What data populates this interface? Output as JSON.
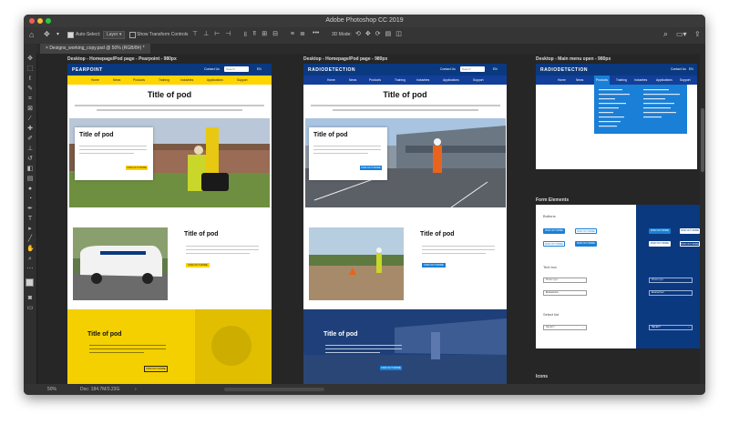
{
  "window": {
    "title": "Adobe Photoshop CC 2019",
    "traffic_colors": [
      "#ee5f57",
      "#f5bf2f",
      "#2bc840"
    ]
  },
  "options_bar": {
    "home_icon": "home-icon",
    "move_icon": "move-tool-icon",
    "auto_select_label": "Auto-Select:",
    "auto_select_value": "Layer",
    "transform_label": "Show Transform Controls",
    "more_label": "•••",
    "mode_3d_label": "3D Mode:",
    "right_icons": [
      "search-icon",
      "workspace-icon",
      "share-icon"
    ]
  },
  "document_tab": {
    "label": "Designs_working_copy.psd @ 50% (RGB/8#) *"
  },
  "status_bar": {
    "zoom": "50%",
    "doc_info": "Doc: 184.7M/3.23G"
  },
  "artboards": {
    "pearpoint": {
      "label": "Desktop - Homepage/Pod page - Pearpoint - 980px",
      "logo": "PEARPOINT",
      "contact": "Contact Us",
      "search_placeholder": "Search",
      "lang": "EN",
      "nav": [
        "Home",
        "News",
        "Products",
        "Training",
        "Industries",
        "Applications",
        "Support"
      ],
      "title": "Title of pod",
      "pods": [
        {
          "title": "Title of pod",
          "button": "FIND OUT MORE"
        },
        {
          "title": "Title of pod",
          "button": "FIND OUT MORE"
        },
        {
          "title": "Title of pod",
          "button": "FIND OUT MORE"
        }
      ],
      "colors": {
        "header": "#0a3980",
        "nav": "#ffd400",
        "accent": "#ffd400"
      }
    },
    "radiodetection": {
      "label": "Desktop - Homepage/Pod page - 980px",
      "logo": "RADIODETECTION",
      "contact": "Contact Us",
      "search_placeholder": "Search",
      "lang": "EN",
      "nav": [
        "Home",
        "News",
        "Products",
        "Training",
        "Industries",
        "Applications",
        "Support"
      ],
      "title": "Title of pod",
      "pods": [
        {
          "title": "Title of pod",
          "button": "FIND OUT MORE"
        },
        {
          "title": "Title of pod",
          "button": "FIND OUT MORE"
        },
        {
          "title": "Title of pod",
          "button": "FIND OUT MORE"
        }
      ],
      "colors": {
        "header": "#0a3980",
        "nav": "#123f99",
        "accent": "#1a7fd6"
      }
    },
    "main_menu": {
      "label": "Desktop - Main menu open - 980px",
      "logo": "RADIODETECTION",
      "contact": "Contact Us",
      "lang": "EN",
      "nav": [
        "Home",
        "News",
        "Products",
        "Training",
        "Industries",
        "Applications",
        "Support"
      ]
    },
    "form_elements": {
      "label": "Form Elements",
      "buttons_heading": "Buttons",
      "button_label": "FIND OUT MORE",
      "textbox_heading": "Text box",
      "textbox_placeholder": "Please type",
      "textbox_entered": "Entered text",
      "select_heading": "Select list",
      "select_value": "SELECT"
    },
    "icons": {
      "label": "Icons"
    }
  }
}
